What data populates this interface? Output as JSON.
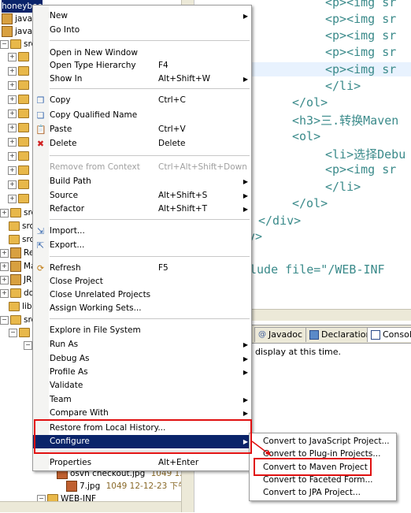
{
  "tree": {
    "rows": [
      {
        "label": "honeybee",
        "selected": true
      },
      {
        "label": "java [t",
        "selected": false
      },
      {
        "label": "javaniu",
        "selected": false
      },
      {
        "label": "src",
        "selected": false
      },
      {
        "label": "",
        "selected": false
      },
      {
        "label": "",
        "selected": false
      },
      {
        "label": "",
        "selected": false
      },
      {
        "label": "",
        "selected": false
      },
      {
        "label": "",
        "selected": false
      },
      {
        "label": "",
        "selected": false
      },
      {
        "label": "",
        "selected": false
      },
      {
        "label": "",
        "selected": false
      },
      {
        "label": "",
        "selected": false
      },
      {
        "label": "",
        "selected": false
      },
      {
        "label": "",
        "selected": false
      },
      {
        "label": "",
        "selected": false
      },
      {
        "label": "src",
        "selected": false
      },
      {
        "label": "src",
        "selected": false
      },
      {
        "label": "src",
        "selected": false
      },
      {
        "label": "Re",
        "selected": false
      },
      {
        "label": "Ma",
        "selected": false
      },
      {
        "label": "JR",
        "selected": false
      },
      {
        "label": "do",
        "selected": false
      },
      {
        "label": "lib",
        "selected": false
      },
      {
        "label": "src",
        "selected": false
      }
    ],
    "files": [
      {
        "name": "osvn checkout.jpg",
        "meta": "1049  12-12"
      },
      {
        "name": "7.jpg",
        "meta": "1049  12-12-23 下午3"
      },
      {
        "name": "WEB-INF",
        "meta": ""
      }
    ]
  },
  "editor": {
    "lines": [
      {
        "indent": "        ",
        "text": "<p><img sr"
      },
      {
        "indent": "        ",
        "text": "<p><img sr"
      },
      {
        "indent": "        ",
        "text": "<p><img sr"
      },
      {
        "indent": "        ",
        "text": "<p><img sr"
      },
      {
        "indent": "        ",
        "text": "<p><img sr"
      },
      {
        "indent": "        ",
        "text": "</li>"
      },
      {
        "indent": "    ",
        "text": "</ol>"
      },
      {
        "indent": "    ",
        "text": "<h3>三.转换Maven"
      },
      {
        "indent": "    ",
        "text": "<ol>"
      },
      {
        "indent": "        ",
        "text": "<li>选择Debu"
      },
      {
        "indent": "        ",
        "text": "<p><img sr"
      },
      {
        "indent": "        ",
        "text": "</li>"
      },
      {
        "indent": "    ",
        "text": "</ol>"
      },
      {
        "indent": "",
        "text": "</div>"
      },
      {
        "indent": "",
        "text": "iv>"
      },
      {
        "indent": "",
        "text": ""
      },
      {
        "indent": "",
        "text": "lude file=\"/WEB-INF"
      }
    ]
  },
  "views": {
    "tabs": [
      {
        "label": "Javadoc",
        "icon": "@"
      },
      {
        "label": "Declaration",
        "icon": "declaration-icon"
      },
      {
        "label": "Console",
        "icon": "console-icon"
      }
    ],
    "message": "display at this time."
  },
  "menu": {
    "items": [
      {
        "label": "New",
        "mnemonic": "w",
        "shortcut": "",
        "submenu": true,
        "disabled": false,
        "icon": ""
      },
      {
        "label": "Go Into",
        "shortcut": "",
        "submenu": false,
        "disabled": false,
        "icon": ""
      },
      {
        "label": "Open in New Window",
        "shortcut": "",
        "submenu": false,
        "disabled": false,
        "icon": ""
      },
      {
        "label": "Open Type Hierarchy",
        "shortcut": "F4",
        "submenu": false,
        "disabled": false,
        "icon": ""
      },
      {
        "label": "Show In",
        "shortcut": "Alt+Shift+W",
        "submenu": true,
        "disabled": false,
        "icon": ""
      },
      {
        "label": "Copy",
        "shortcut": "Ctrl+C",
        "submenu": false,
        "disabled": false,
        "icon": "copy-icon"
      },
      {
        "label": "Copy Qualified Name",
        "shortcut": "",
        "submenu": false,
        "disabled": false,
        "icon": "copy-qualified-icon"
      },
      {
        "label": "Paste",
        "shortcut": "Ctrl+V",
        "submenu": false,
        "disabled": false,
        "icon": "paste-icon"
      },
      {
        "label": "Delete",
        "shortcut": "Delete",
        "submenu": false,
        "disabled": false,
        "icon": "delete-icon"
      },
      {
        "label": "Remove from Context",
        "shortcut": "Ctrl+Alt+Shift+Down",
        "submenu": false,
        "disabled": true,
        "icon": ""
      },
      {
        "label": "Build Path",
        "shortcut": "",
        "submenu": true,
        "disabled": false,
        "icon": ""
      },
      {
        "label": "Source",
        "shortcut": "Alt+Shift+S",
        "submenu": true,
        "disabled": false,
        "icon": ""
      },
      {
        "label": "Refactor",
        "shortcut": "Alt+Shift+T",
        "submenu": true,
        "disabled": false,
        "icon": ""
      },
      {
        "label": "Import...",
        "shortcut": "",
        "submenu": false,
        "disabled": false,
        "icon": "import-icon"
      },
      {
        "label": "Export...",
        "shortcut": "",
        "submenu": false,
        "disabled": false,
        "icon": "export-icon"
      },
      {
        "label": "Refresh",
        "shortcut": "F5",
        "submenu": false,
        "disabled": false,
        "icon": "refresh-icon"
      },
      {
        "label": "Close Project",
        "shortcut": "",
        "submenu": false,
        "disabled": false,
        "icon": ""
      },
      {
        "label": "Close Unrelated Projects",
        "shortcut": "",
        "submenu": false,
        "disabled": false,
        "icon": ""
      },
      {
        "label": "Assign Working Sets...",
        "shortcut": "",
        "submenu": false,
        "disabled": false,
        "icon": ""
      },
      {
        "label": "Explore in File System",
        "shortcut": "",
        "submenu": false,
        "disabled": false,
        "icon": ""
      },
      {
        "label": "Run As",
        "shortcut": "",
        "submenu": true,
        "disabled": false,
        "icon": ""
      },
      {
        "label": "Debug As",
        "shortcut": "",
        "submenu": true,
        "disabled": false,
        "icon": ""
      },
      {
        "label": "Profile As",
        "shortcut": "",
        "submenu": true,
        "disabled": false,
        "icon": ""
      },
      {
        "label": "Validate",
        "shortcut": "",
        "submenu": false,
        "disabled": false,
        "icon": ""
      },
      {
        "label": "Team",
        "shortcut": "",
        "submenu": true,
        "disabled": false,
        "icon": ""
      },
      {
        "label": "Compare With",
        "shortcut": "",
        "submenu": true,
        "disabled": false,
        "icon": ""
      },
      {
        "label": "Restore from Local History...",
        "shortcut": "",
        "submenu": false,
        "disabled": false,
        "icon": ""
      },
      {
        "label": "Configure",
        "shortcut": "",
        "submenu": true,
        "disabled": false,
        "icon": "",
        "active": true
      },
      {
        "label": "Properties",
        "shortcut": "Alt+Enter",
        "submenu": false,
        "disabled": false,
        "icon": ""
      }
    ]
  },
  "submenu": {
    "items": [
      {
        "label": "Convert to JavaScript Project..."
      },
      {
        "label": "Convert to Plug-in Projects..."
      },
      {
        "label": "Convert to Maven Project"
      },
      {
        "label": "Convert to Faceted Form..."
      },
      {
        "label": "Convert to JPA Project..."
      }
    ]
  },
  "colors": {
    "selection": "#0a246a",
    "annotation": "#e01010",
    "tag": "#3a8a8a"
  }
}
